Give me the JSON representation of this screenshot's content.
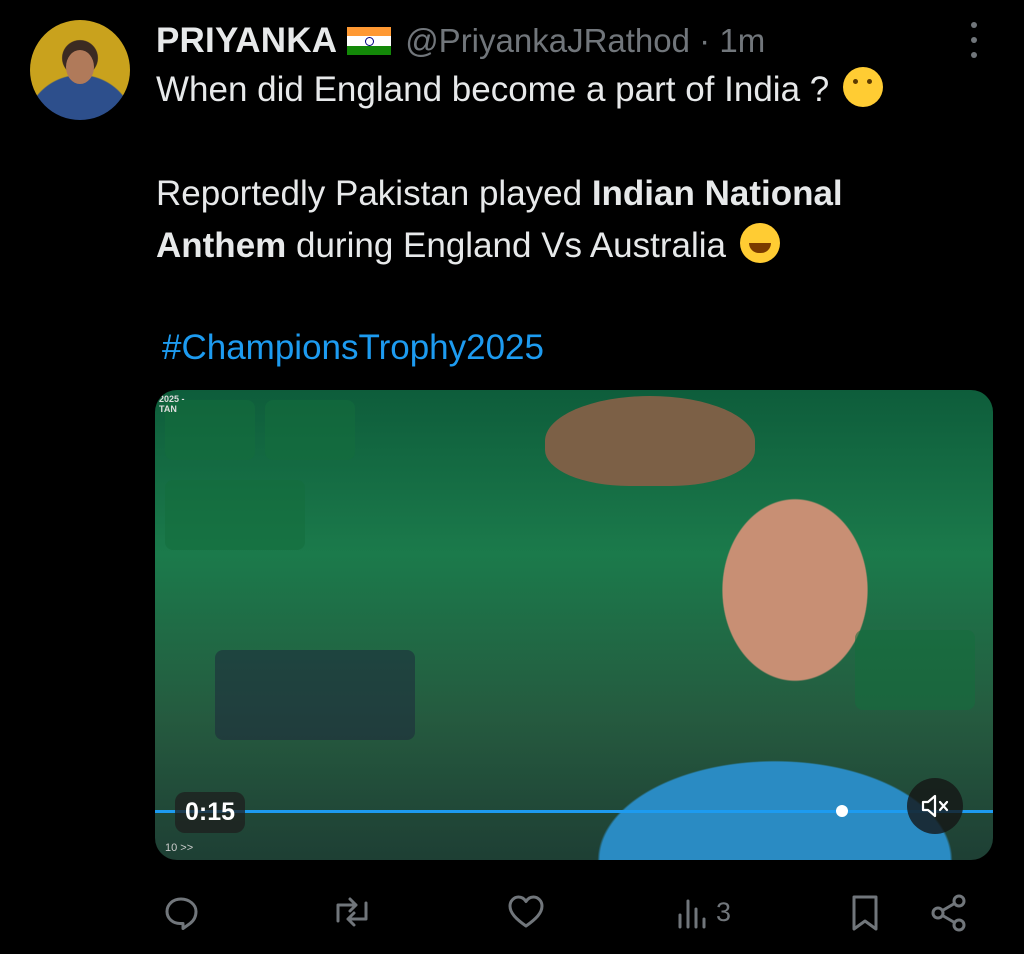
{
  "tweet": {
    "author": {
      "name": "PRIYANKA",
      "flag_icon": "india-flag-icon",
      "handle": "@PriyankaJRathod",
      "separator": "·",
      "time": "1m"
    },
    "line1": "When did England become a part of India ?",
    "line2_part1": "Reportedly Pakistan played ",
    "line2_bold": "Indian National",
    "line3_bold": "Anthem",
    "line3_rest": " during England Vs Australia",
    "hashtag": "#ChampionsTrophy2025",
    "emojis": [
      "thinking-face-emoji",
      "tears-of-joy-emoji"
    ]
  },
  "video": {
    "watermark_line1": "2025 -",
    "watermark_line2": "TAN",
    "timestamp": "0:15",
    "progress": 0.82,
    "small_controls": "10 >>",
    "mute_icon": "volume-muted-icon"
  },
  "actions": {
    "reply_icon": "reply-icon",
    "retweet_icon": "retweet-icon",
    "like_icon": "heart-icon",
    "views_icon": "views-icon",
    "views_count": "3",
    "bookmark_icon": "bookmark-icon",
    "share_icon": "share-icon"
  },
  "colors": {
    "background": "#000000",
    "text": "#e7e9ea",
    "muted": "#71767b",
    "link": "#1d9bf0"
  }
}
